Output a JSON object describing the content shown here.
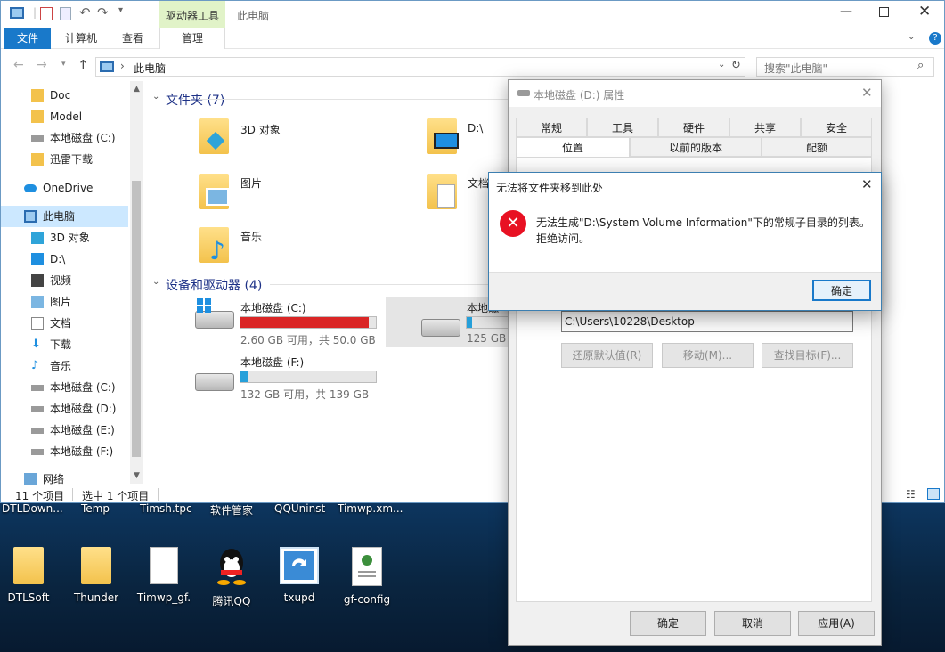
{
  "colors": {
    "accent": "#1979ca",
    "drive_full": "#da2626",
    "drive_normal": "#26a0da",
    "error_red": "#e81123"
  },
  "explorer": {
    "title": "此电脑",
    "context_tab": "驱动器工具",
    "tabs": [
      "文件",
      "计算机",
      "查看",
      "管理"
    ],
    "address": "此电脑",
    "search_placeholder": "搜索\"此电脑\"",
    "nav": [
      {
        "label": "Doc",
        "icon": "folder-icon"
      },
      {
        "label": "Model",
        "icon": "folder-icon"
      },
      {
        "label": "本地磁盘 (C:)",
        "icon": "drive-icon"
      },
      {
        "label": "迅雷下载",
        "icon": "folder-icon"
      },
      {
        "label": "OneDrive",
        "icon": "onedrive-icon"
      },
      {
        "label": "此电脑",
        "icon": "this-pc-icon"
      },
      {
        "label": "3D 对象",
        "icon": "3d-objects-icon"
      },
      {
        "label": "D:\\",
        "icon": "folder-desktop-icon"
      },
      {
        "label": "视频",
        "icon": "video-icon"
      },
      {
        "label": "图片",
        "icon": "pictures-icon"
      },
      {
        "label": "文档",
        "icon": "documents-icon"
      },
      {
        "label": "下载",
        "icon": "download-icon"
      },
      {
        "label": "音乐",
        "icon": "music-icon"
      },
      {
        "label": "本地磁盘 (C:)",
        "icon": "drive-icon"
      },
      {
        "label": "本地磁盘 (D:)",
        "icon": "drive-icon"
      },
      {
        "label": "本地磁盘 (E:)",
        "icon": "drive-icon"
      },
      {
        "label": "本地磁盘 (F:)",
        "icon": "drive-icon"
      },
      {
        "label": "网络",
        "icon": "network-icon"
      }
    ],
    "folders_header": "文件夹 (7)",
    "folders": [
      "3D 对象",
      "D:\\",
      "图片",
      "文档",
      "音乐"
    ],
    "devices_header": "设备和驱动器 (4)",
    "drives": [
      {
        "name": "本地磁盘 (C:)",
        "info": "2.60 GB 可用，共 50.0 GB",
        "used_fraction": 0.948
      },
      {
        "name": "本地磁",
        "info": "125 GB",
        "used_fraction": 0.1
      },
      {
        "name": "本地磁盘 (F:)",
        "info": "132 GB 可用，共 139 GB",
        "used_fraction": 0.05
      }
    ],
    "status_items": "11 个项目",
    "status_selected": "选中 1 个项目"
  },
  "properties": {
    "title": "本地磁盘 (D:) 属性",
    "tabs_row1": [
      "常规",
      "工具",
      "硬件",
      "共享",
      "安全"
    ],
    "tabs_row2": [
      "位置",
      "以前的版本",
      "配额"
    ],
    "path_value": "C:\\Users\\10228\\Desktop",
    "btn_restore": "还原默认值(R)",
    "btn_move": "移动(M)...",
    "btn_find": "查找目标(F)...",
    "btn_ok": "确定",
    "btn_cancel": "取消",
    "btn_apply": "应用(A)"
  },
  "error": {
    "title": "无法将文件夹移到此处",
    "line1": "无法生成\"D:\\System Volume Information\"下的常规子目录的列表。",
    "line2": "拒绝访问。",
    "ok": "确定"
  },
  "desktop": {
    "top_labels": [
      "DTLDown...",
      "Temp",
      "Timsh.tpc",
      "软件管家",
      "QQUninst",
      "Timwp.xm..."
    ],
    "icons": [
      {
        "label": "DTLSoft",
        "icon": "folder-icon"
      },
      {
        "label": "Thunder",
        "icon": "folder-icon"
      },
      {
        "label": "Timwp_gf.",
        "icon": "file-icon"
      },
      {
        "label": "腾讯QQ",
        "icon": "qq-penguin-icon"
      },
      {
        "label": "txupd",
        "icon": "txupd-icon"
      },
      {
        "label": "gf-config",
        "icon": "config-file-icon"
      }
    ]
  }
}
